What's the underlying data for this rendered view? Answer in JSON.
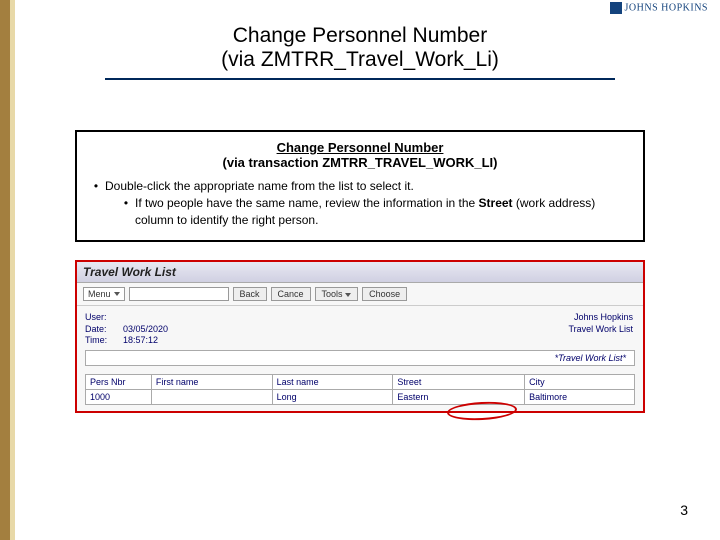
{
  "logo": {
    "text": "JOHNS HOPKINS"
  },
  "title": {
    "line1": "Change Personnel Number",
    "line2": "(via ZMTRR_Travel_Work_Li)"
  },
  "infobox": {
    "heading": "Change Personnel Number",
    "sub": "(via transaction ZMTRR_TRAVEL_WORK_LI)",
    "bullet": "Double-click the appropriate name from the list to select it.",
    "subbullet_pre": "If two people have the same name, review the information in the ",
    "subbullet_bold": "Street",
    "subbullet_post": " (work address) column to identify the right person."
  },
  "sap": {
    "title": "Travel Work List",
    "menu": "Menu",
    "buttons": {
      "back": "Back",
      "cancel": "Cance",
      "tools": "Tools",
      "choose": "Choose"
    },
    "left": {
      "user_lbl": "User:",
      "date_lbl": "Date:",
      "date_val": "03/05/2020",
      "time_lbl": "Time:",
      "time_val": "18:57:12"
    },
    "right": {
      "org": "Johns Hopkins",
      "title2": "Travel Work List"
    },
    "section": "*Travel Work List*",
    "headers": {
      "pers": "Pers Nbr",
      "first": "First name",
      "last": "Last name",
      "street": "Street",
      "city": "City"
    },
    "row1": {
      "pers": "1000",
      "first": "",
      "last": "Long",
      "street": "Eastern",
      "city": "Baltimore"
    }
  },
  "page": "3"
}
